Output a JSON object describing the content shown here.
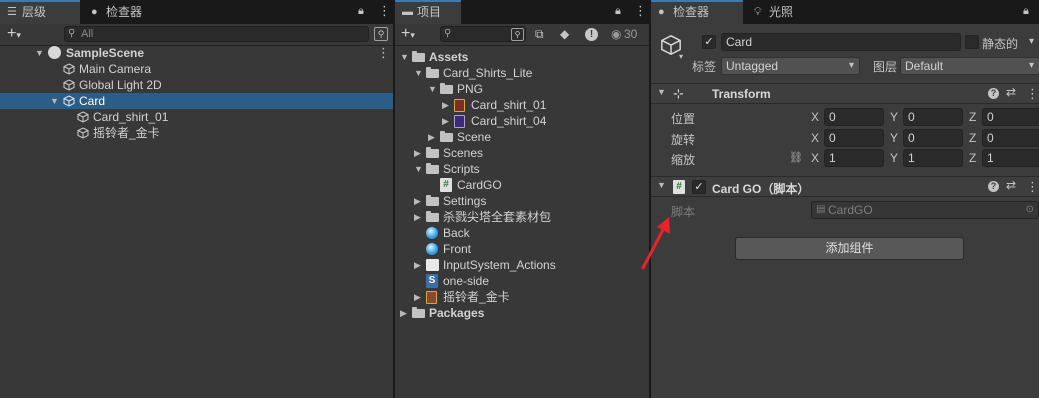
{
  "hierarchy": {
    "tabs": [
      {
        "label": "层级",
        "icon": "list-icon"
      },
      {
        "label": "检查器",
        "icon": "info-icon"
      }
    ],
    "search_placeholder": "All",
    "scene": "SampleScene",
    "items": [
      {
        "label": "Main Camera"
      },
      {
        "label": "Global Light 2D"
      },
      {
        "label": "Card",
        "selected": true
      },
      {
        "label": "Card_shirt_01"
      },
      {
        "label": "摇铃者_金卡"
      }
    ]
  },
  "project": {
    "tab": {
      "label": "项目",
      "icon": "folder-icon"
    },
    "hidden_count": "30",
    "tree": [
      {
        "label": "Assets",
        "bold": true
      },
      {
        "label": "Card_Shirts_Lite"
      },
      {
        "label": "PNG"
      },
      {
        "label": "Card_shirt_01"
      },
      {
        "label": "Card_shirt_04"
      },
      {
        "label": "Scene"
      },
      {
        "label": "Scenes"
      },
      {
        "label": "Scripts"
      },
      {
        "label": "CardGO"
      },
      {
        "label": "Settings"
      },
      {
        "label": "杀戮尖塔全套素材包"
      },
      {
        "label": "Back"
      },
      {
        "label": "Front"
      },
      {
        "label": "InputSystem_Actions"
      },
      {
        "label": "one-side"
      },
      {
        "label": "摇铃者_金卡"
      },
      {
        "label": "Packages",
        "bold": true
      }
    ]
  },
  "inspector": {
    "tabs": [
      {
        "label": "检查器",
        "icon": "info-icon"
      },
      {
        "label": "光照",
        "icon": "bulb-icon"
      }
    ],
    "object_name": "Card",
    "static_label": "静态的",
    "tag_label": "标签",
    "tag_value": "Untagged",
    "layer_label": "图层",
    "layer_value": "Default",
    "transform": {
      "title": "Transform",
      "rows": [
        {
          "label": "位置",
          "x": "0",
          "y": "0",
          "z": "0"
        },
        {
          "label": "旋转",
          "x": "0",
          "y": "0",
          "z": "0"
        },
        {
          "label": "缩放",
          "x": "1",
          "y": "1",
          "z": "1"
        }
      ],
      "axes": [
        "X",
        "Y",
        "Z"
      ]
    },
    "script_component": {
      "title": "Card GO（脚本）",
      "script_label": "脚本",
      "script_value": "CardGO"
    },
    "add_component": "添加组件"
  }
}
